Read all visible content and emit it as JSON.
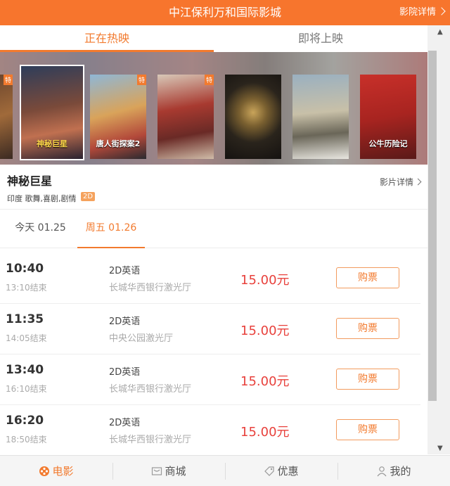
{
  "header": {
    "title": "中江保利万和国际影城",
    "detail_link": "影院详情"
  },
  "tabs": [
    {
      "label": "正在热映",
      "active": true
    },
    {
      "label": "即将上映",
      "active": false
    }
  ],
  "posters": [
    {
      "tag": "特",
      "title": ""
    },
    {
      "tag": "",
      "title": "神秘巨星",
      "selected": true
    },
    {
      "tag": "特",
      "title": "唐人街探案2"
    },
    {
      "tag": "特",
      "title": ""
    },
    {
      "tag": "",
      "title": ""
    },
    {
      "tag": "",
      "title": ""
    },
    {
      "tag": "",
      "title": "公牛历险记"
    }
  ],
  "movie": {
    "title": "神秘巨星",
    "meta": "印度 歌舞,喜剧,剧情",
    "badge": "2D",
    "detail_link": "影片详情"
  },
  "dates": [
    {
      "label": "今天 01.25",
      "active": false
    },
    {
      "label": "周五 01.26",
      "active": true
    }
  ],
  "sessions": [
    {
      "start": "10:40",
      "end": "13:10结束",
      "lang": "2D英语",
      "hall": "长城华西银行激光厅",
      "price": "15.00元",
      "buy": "购票"
    },
    {
      "start": "11:35",
      "end": "14:05结束",
      "lang": "2D英语",
      "hall": "中央公园激光厅",
      "price": "15.00元",
      "buy": "购票"
    },
    {
      "start": "13:40",
      "end": "16:10结束",
      "lang": "2D英语",
      "hall": "长城华西银行激光厅",
      "price": "15.00元",
      "buy": "购票"
    },
    {
      "start": "16:20",
      "end": "18:50结束",
      "lang": "2D英语",
      "hall": "长城华西银行激光厅",
      "price": "15.00元",
      "buy": "购票"
    }
  ],
  "bottom_nav": [
    {
      "label": "电影",
      "icon": "film-reel-icon",
      "active": true
    },
    {
      "label": "商城",
      "icon": "shop-icon",
      "active": false
    },
    {
      "label": "优惠",
      "icon": "coupon-tag-icon",
      "active": false
    },
    {
      "label": "我的",
      "icon": "user-icon",
      "active": false
    }
  ],
  "colors": {
    "accent": "#f7752d",
    "price": "#e8413c"
  }
}
